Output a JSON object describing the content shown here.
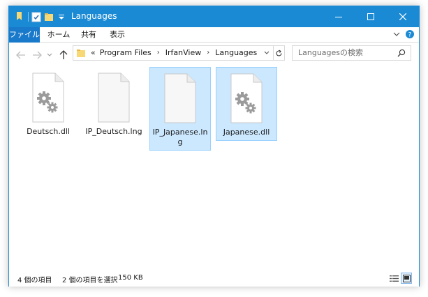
{
  "window": {
    "title": "Languages"
  },
  "ribbon": {
    "tabs": [
      "ファイル",
      "ホーム",
      "共有",
      "表示"
    ]
  },
  "address": {
    "overflow": "«",
    "crumbs": [
      "Program Files",
      "IrfanView",
      "Languages"
    ]
  },
  "search": {
    "placeholder": "Languagesの検索"
  },
  "files": [
    {
      "name": "Deutsch.dll",
      "type": "dll",
      "selected": false
    },
    {
      "name": "IP_Deutsch.lng",
      "type": "lng",
      "selected": false
    },
    {
      "name": "IP_Japanese.lng",
      "type": "lng",
      "selected": true
    },
    {
      "name": "Japanese.dll",
      "type": "dll",
      "selected": true
    }
  ],
  "status": {
    "item_count": "4 個の項目",
    "selection": "2 個の項目を選択",
    "size": "150 KB"
  },
  "colors": {
    "titlebar": "#1a8ad4",
    "file_tab": "#1979ca",
    "selection_fill": "#cce8ff",
    "selection_border": "#99d1ff",
    "folder": "#f8d775"
  },
  "icons": {
    "back": "arrow-left-icon",
    "forward": "arrow-right-icon",
    "recent": "chevron-down-icon",
    "up": "arrow-up-icon",
    "refresh": "refresh-icon",
    "search": "search-icon",
    "help": "help-icon"
  }
}
